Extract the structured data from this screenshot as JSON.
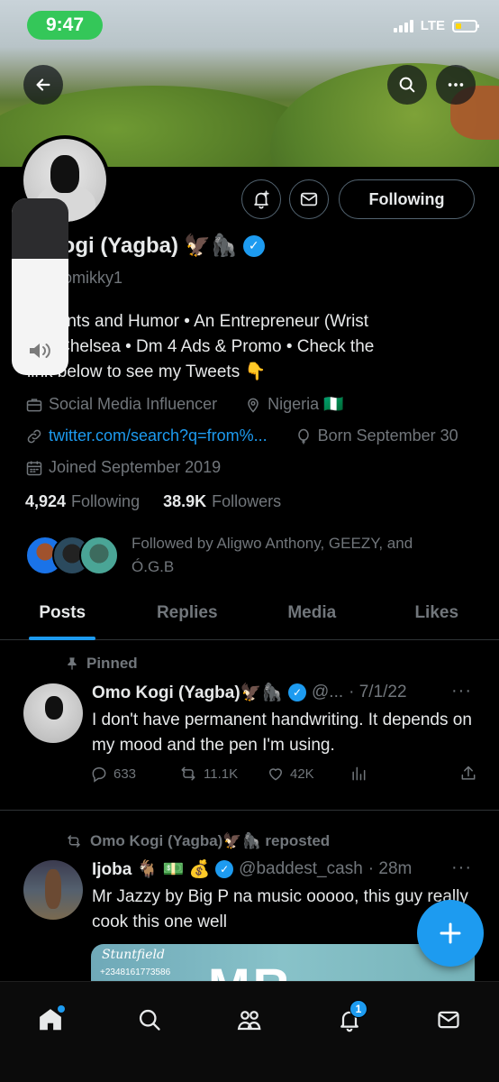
{
  "status_bar": {
    "time": "9:47",
    "network": "LTE"
  },
  "profile": {
    "name_visible": "o Kogi (Yagba)",
    "name_emoji": "🦅🦍",
    "handle_visible": "adapomikky1",
    "bio_line1": "e, Bants and Humor • An Entrepreneur (Wrist",
    "bio_line2": "h) • Chelsea • Dm 4 Ads & Promo • Check the",
    "bio_line3": "link below to see my Tweets 👇",
    "category": "Social Media Influencer",
    "location": "Nigeria 🇳🇬",
    "link": "twitter.com/search?q=from%...",
    "born": "Born September 30",
    "joined": "Joined September 2019",
    "following_count": "4,924",
    "following_label": "Following",
    "followers_count": "38.9K",
    "followers_label": "Followers",
    "followed_by": "Followed by Aligwo Anthony, GEEZY, and Ó.G.B",
    "following_button": "Following"
  },
  "tabs": [
    "Posts",
    "Replies",
    "Media",
    "Likes"
  ],
  "posts": [
    {
      "context": "Pinned",
      "author": "Omo Kogi (Yagba)🦅🦍",
      "handle": "@...",
      "date": "· 7/1/22",
      "text": "I don't have permanent handwriting. It depends on my mood and the pen I'm using.",
      "replies": "633",
      "reposts": "11.1K",
      "likes": "42K"
    },
    {
      "context": "Omo Kogi (Yagba)🦅🦍 reposted",
      "author": "Ijoba 🐐 💵 💰",
      "handle": "@baddest_cash",
      "date": "· 28m",
      "text": "Mr Jazzy by Big P na music ooooo, this guy really cook this one well",
      "media_brand": "Stuntfield",
      "media_phone": "+2348161773586",
      "media_title": "MR JAZZY"
    }
  ],
  "bottom_nav": {
    "notification_count": "1"
  },
  "colors": {
    "accent": "#1d9bf0",
    "background": "#000000",
    "muted": "#71767b",
    "text": "#e7e9ea"
  }
}
